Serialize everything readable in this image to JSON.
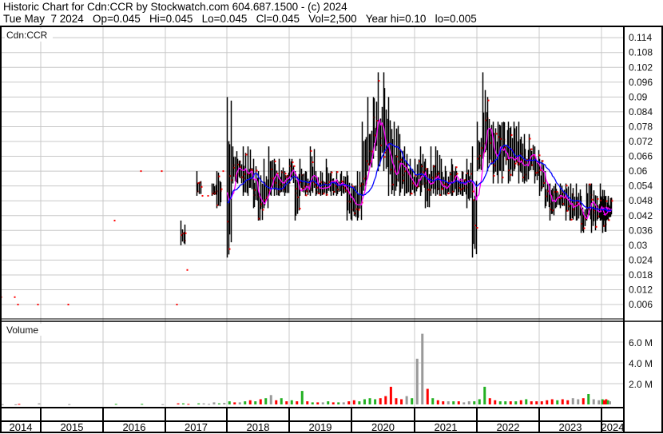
{
  "header": {
    "title": "Historic Chart for Cdn:CCR by Stockwatch.com 604.687.1500 - (c) 2024",
    "quote": "Tue May  7 2024   Op=0.045   Hi=0.045   Lo=0.045   Cl=0.045   Vol=2,500   Year hi=0.10   lo=0.005"
  },
  "price_panel": {
    "label": "Cdn:CCR",
    "y_ticks": [
      "0.114",
      "0.108",
      "0.102",
      "0.096",
      "0.09",
      "0.084",
      "0.078",
      "0.072",
      "0.066",
      "0.06",
      "0.054",
      "0.048",
      "0.042",
      "0.036",
      "0.03",
      "0.024",
      "0.018",
      "0.012",
      "0.006"
    ]
  },
  "volume_panel": {
    "label": "Volume",
    "y_ticks": [
      "6.0 M",
      "4.0 M",
      "2.0 M"
    ]
  },
  "years": [
    "2014",
    "2015",
    "2016",
    "2017",
    "2018",
    "2019",
    "2020",
    "2021",
    "2022",
    "2023",
    "2024"
  ],
  "colors": {
    "up": "#22b022",
    "down": "#ff0000",
    "flat": "#999999",
    "ma_short": "#ff00ff",
    "ma_long": "#0000ff",
    "bar": "#000000",
    "grid": "#c8c8c8"
  },
  "chart_data": {
    "type": "line",
    "note": "monthly approx: [month index from Jan 2014, high, low, close, volume in millions]",
    "ylim": [
      0,
      0.117
    ],
    "series": [
      [
        0,
        0.009,
        0.009,
        0.009,
        0.02
      ],
      [
        4,
        0.009,
        0.009,
        0.009,
        0.01
      ],
      [
        5,
        0.006,
        0.006,
        0.006,
        0.05
      ],
      [
        11,
        0.006,
        0.006,
        0.006,
        0.1
      ],
      [
        17,
        0.006,
        0.006,
        0.006,
        0.03
      ],
      [
        26,
        0.04,
        0.04,
        0.04,
        0.05
      ],
      [
        31,
        0.06,
        0.06,
        0.06,
        0.05
      ],
      [
        35,
        0.06,
        0.06,
        0.06,
        0.02
      ],
      [
        38,
        0.006,
        0.006,
        0.006,
        0.1
      ],
      [
        39,
        0.04,
        0.03,
        0.04,
        0.1
      ],
      [
        40,
        0.02,
        0.02,
        0.02,
        0.05
      ],
      [
        42,
        0.06,
        0.05,
        0.05,
        0.1
      ],
      [
        43,
        0.05,
        0.05,
        0.05,
        0.1
      ],
      [
        44,
        0.05,
        0.05,
        0.05,
        0.05
      ],
      [
        45,
        0.055,
        0.05,
        0.05,
        0.2
      ],
      [
        46,
        0.06,
        0.045,
        0.06,
        0.1
      ],
      [
        47,
        0.06,
        0.06,
        0.06,
        0.15
      ],
      [
        48,
        0.09,
        0.025,
        0.065,
        0.3
      ],
      [
        49,
        0.07,
        0.055,
        0.06,
        0.2
      ],
      [
        50,
        0.065,
        0.055,
        0.06,
        0.2
      ],
      [
        51,
        0.07,
        0.05,
        0.062,
        0.3
      ],
      [
        52,
        0.07,
        0.05,
        0.055,
        0.4
      ],
      [
        53,
        0.065,
        0.045,
        0.06,
        0.3
      ],
      [
        54,
        0.06,
        0.04,
        0.055,
        0.5
      ],
      [
        55,
        0.065,
        0.045,
        0.06,
        0.6
      ],
      [
        56,
        0.07,
        0.05,
        0.06,
        0.9
      ],
      [
        57,
        0.065,
        0.05,
        0.055,
        0.4
      ],
      [
        58,
        0.065,
        0.05,
        0.06,
        0.6
      ],
      [
        59,
        0.06,
        0.05,
        0.055,
        0.3
      ],
      [
        60,
        0.065,
        0.055,
        0.06,
        0.4
      ],
      [
        61,
        0.06,
        0.04,
        0.055,
        0.3
      ],
      [
        62,
        0.065,
        0.05,
        0.06,
        1.3
      ],
      [
        63,
        0.06,
        0.05,
        0.055,
        0.3
      ],
      [
        64,
        0.07,
        0.05,
        0.06,
        0.2
      ],
      [
        65,
        0.06,
        0.05,
        0.055,
        0.2
      ],
      [
        66,
        0.06,
        0.05,
        0.055,
        0.2
      ],
      [
        67,
        0.065,
        0.05,
        0.06,
        0.3
      ],
      [
        68,
        0.06,
        0.05,
        0.055,
        0.2
      ],
      [
        69,
        0.06,
        0.05,
        0.058,
        0.2
      ],
      [
        70,
        0.06,
        0.05,
        0.058,
        0.2
      ],
      [
        71,
        0.06,
        0.04,
        0.055,
        0.3
      ],
      [
        72,
        0.055,
        0.04,
        0.045,
        0.4
      ],
      [
        73,
        0.06,
        0.04,
        0.05,
        0.3
      ],
      [
        74,
        0.08,
        0.05,
        0.065,
        0.5
      ],
      [
        75,
        0.09,
        0.06,
        0.075,
        0.6
      ],
      [
        76,
        0.09,
        0.065,
        0.08,
        0.5
      ],
      [
        77,
        0.1,
        0.06,
        0.075,
        0.6
      ],
      [
        78,
        0.1,
        0.06,
        0.07,
        0.8
      ],
      [
        79,
        0.09,
        0.05,
        0.065,
        1.7
      ],
      [
        80,
        0.08,
        0.05,
        0.06,
        0.6
      ],
      [
        81,
        0.075,
        0.05,
        0.055,
        0.5
      ],
      [
        82,
        0.07,
        0.05,
        0.055,
        0.8
      ],
      [
        83,
        0.065,
        0.05,
        0.06,
        0.6
      ],
      [
        84,
        0.065,
        0.05,
        0.06,
        4.4
      ],
      [
        85,
        0.07,
        0.05,
        0.06,
        6.8
      ],
      [
        86,
        0.065,
        0.045,
        0.055,
        1.5
      ],
      [
        87,
        0.07,
        0.05,
        0.065,
        0.6
      ],
      [
        88,
        0.07,
        0.05,
        0.06,
        0.4
      ],
      [
        89,
        0.065,
        0.05,
        0.055,
        0.3
      ],
      [
        90,
        0.06,
        0.05,
        0.055,
        0.3
      ],
      [
        91,
        0.065,
        0.05,
        0.06,
        0.3
      ],
      [
        92,
        0.06,
        0.05,
        0.055,
        0.3
      ],
      [
        93,
        0.06,
        0.05,
        0.055,
        0.2
      ],
      [
        94,
        0.065,
        0.045,
        0.055,
        0.3
      ],
      [
        95,
        0.07,
        0.025,
        0.065,
        0.3
      ],
      [
        96,
        0.08,
        0.06,
        0.075,
        0.5
      ],
      [
        97,
        0.1,
        0.065,
        0.085,
        1.7
      ],
      [
        98,
        0.09,
        0.06,
        0.07,
        0.6
      ],
      [
        99,
        0.08,
        0.055,
        0.065,
        0.4
      ],
      [
        100,
        0.08,
        0.055,
        0.07,
        0.3
      ],
      [
        101,
        0.08,
        0.06,
        0.075,
        0.3
      ],
      [
        102,
        0.08,
        0.055,
        0.07,
        0.3
      ],
      [
        103,
        0.08,
        0.06,
        0.075,
        0.3
      ],
      [
        104,
        0.08,
        0.055,
        0.065,
        0.4
      ],
      [
        105,
        0.075,
        0.055,
        0.07,
        0.5
      ],
      [
        106,
        0.075,
        0.06,
        0.068,
        0.3
      ],
      [
        107,
        0.07,
        0.055,
        0.06,
        0.3
      ],
      [
        108,
        0.065,
        0.05,
        0.055,
        0.3
      ],
      [
        109,
        0.06,
        0.045,
        0.05,
        0.4
      ],
      [
        110,
        0.055,
        0.04,
        0.048,
        0.5
      ],
      [
        111,
        0.055,
        0.045,
        0.05,
        0.4
      ],
      [
        112,
        0.055,
        0.045,
        0.048,
        0.5
      ],
      [
        113,
        0.055,
        0.04,
        0.045,
        0.4
      ],
      [
        114,
        0.055,
        0.04,
        0.045,
        0.6
      ],
      [
        115,
        0.055,
        0.04,
        0.045,
        0.5
      ],
      [
        116,
        0.05,
        0.035,
        0.042,
        0.6
      ],
      [
        117,
        0.055,
        0.04,
        0.045,
        1.0
      ],
      [
        118,
        0.055,
        0.035,
        0.045,
        0.5
      ],
      [
        119,
        0.05,
        0.04,
        0.045,
        0.4
      ],
      [
        120,
        0.055,
        0.04,
        0.048,
        0.5
      ],
      [
        121,
        0.05,
        0.035,
        0.045,
        0.4
      ],
      [
        122,
        0.05,
        0.04,
        0.042,
        0.5
      ],
      [
        123,
        0.05,
        0.04,
        0.045,
        0.4
      ],
      [
        124,
        0.05,
        0.04,
        0.045,
        0.3
      ]
    ]
  }
}
